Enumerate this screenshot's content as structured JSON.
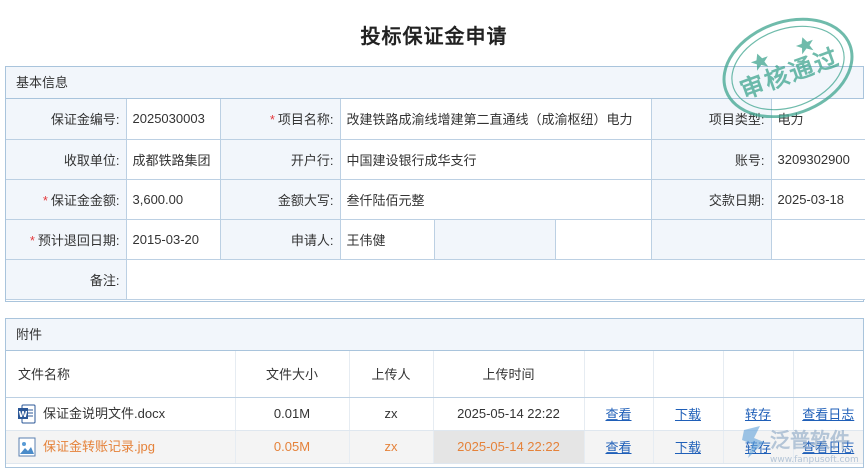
{
  "page": {
    "title": "投标保证金申请"
  },
  "basic": {
    "section_title": "基本信息",
    "labels": {
      "deposit_no": "保证金编号:",
      "project_name": "项目名称:",
      "project_type": "项目类型:",
      "receiver": "收取单位:",
      "bank": "开户行:",
      "account": "账号:",
      "amount": "保证金金额:",
      "amount_upper": "金额大写:",
      "pay_date": "交款日期:",
      "refund_date": "预计退回日期:",
      "applicant": "申请人:",
      "remark": "备注:"
    },
    "values": {
      "deposit_no": "2025030003",
      "project_name": "改建铁路成渝线增建第二直通线（成渝枢纽）电力",
      "project_type": "电力",
      "receiver": "成都铁路集团",
      "bank": "中国建设银行成华支行",
      "account": "3209302900",
      "amount": "3,600.00",
      "amount_upper": "叁仟陆佰元整",
      "pay_date": "2025-03-18",
      "refund_date": "2015-03-20",
      "applicant": "王伟健",
      "remark": ""
    }
  },
  "attachments": {
    "section_title": "附件",
    "columns": [
      "文件名称",
      "文件大小",
      "上传人",
      "上传时间"
    ],
    "rows": [
      {
        "name": "保证金说明文件.docx",
        "size": "0.01M",
        "uploader": "zx",
        "time": "2025-05-14 22:22",
        "icon": "word-doc-icon"
      },
      {
        "name": "保证金转账记录.jpg",
        "size": "0.05M",
        "uploader": "zx",
        "time": "2025-05-14 22:22",
        "icon": "image-file-icon"
      }
    ],
    "actions": {
      "view": "查看",
      "download": "下载",
      "transfer": "转存",
      "log": "查看日志"
    }
  },
  "stamp": {
    "text": "审核通过",
    "color": "#3fa58f"
  },
  "watermark": {
    "brand": "泛普软件",
    "url": "www.fanpusoft.com"
  },
  "colors": {
    "header_bg": "#f2f6fb",
    "border": "#a9c4dc",
    "link": "#1f5fb8",
    "required": "#e4393c",
    "highlight_text": "#e5823a"
  }
}
